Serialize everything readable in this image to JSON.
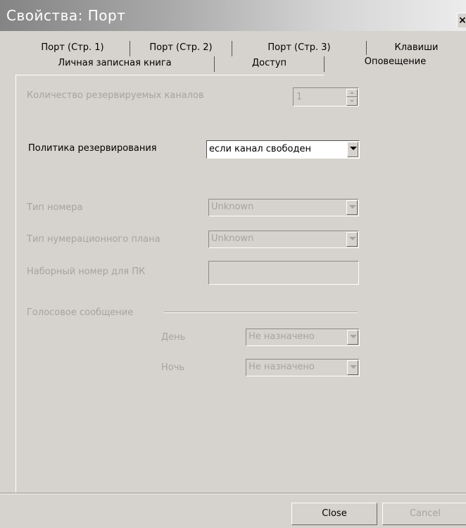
{
  "window": {
    "title": "Свойства: Порт",
    "close_glyph": "×"
  },
  "tabs_row1": [
    "Порт (Стр. 1)",
    "Порт (Стр. 2)",
    "Порт (Стр. 3)",
    "Клавиши"
  ],
  "tabs_row2": [
    "Личная записная книга",
    "Доступ",
    "Оповещение"
  ],
  "active_tab": "Оповещение",
  "form": {
    "reserved_channels_label": "Количество резервируемых каналов",
    "reserved_channels_value": "1",
    "policy_label": "Политика резервирования",
    "policy_value": "если канал свободен",
    "number_type_label": "Тип номера",
    "number_type_value": "Unknown",
    "numbering_plan_label": "Тип нумерационного плана",
    "numbering_plan_value": "Unknown",
    "pc_dial_number_label": "Наборный номер для ПК",
    "pc_dial_number_value": "",
    "voice_group_label": "Голосовое сообщение",
    "day_label": "День",
    "day_value": "Не назначено",
    "night_label": "Ночь",
    "night_value": "Не назначено"
  },
  "buttons": {
    "close": "Close",
    "cancel": "Cancel"
  },
  "icons": {
    "dropdown": "chevron-down-icon",
    "spinner": "spinner-arrows-icon",
    "close": "close-icon"
  }
}
